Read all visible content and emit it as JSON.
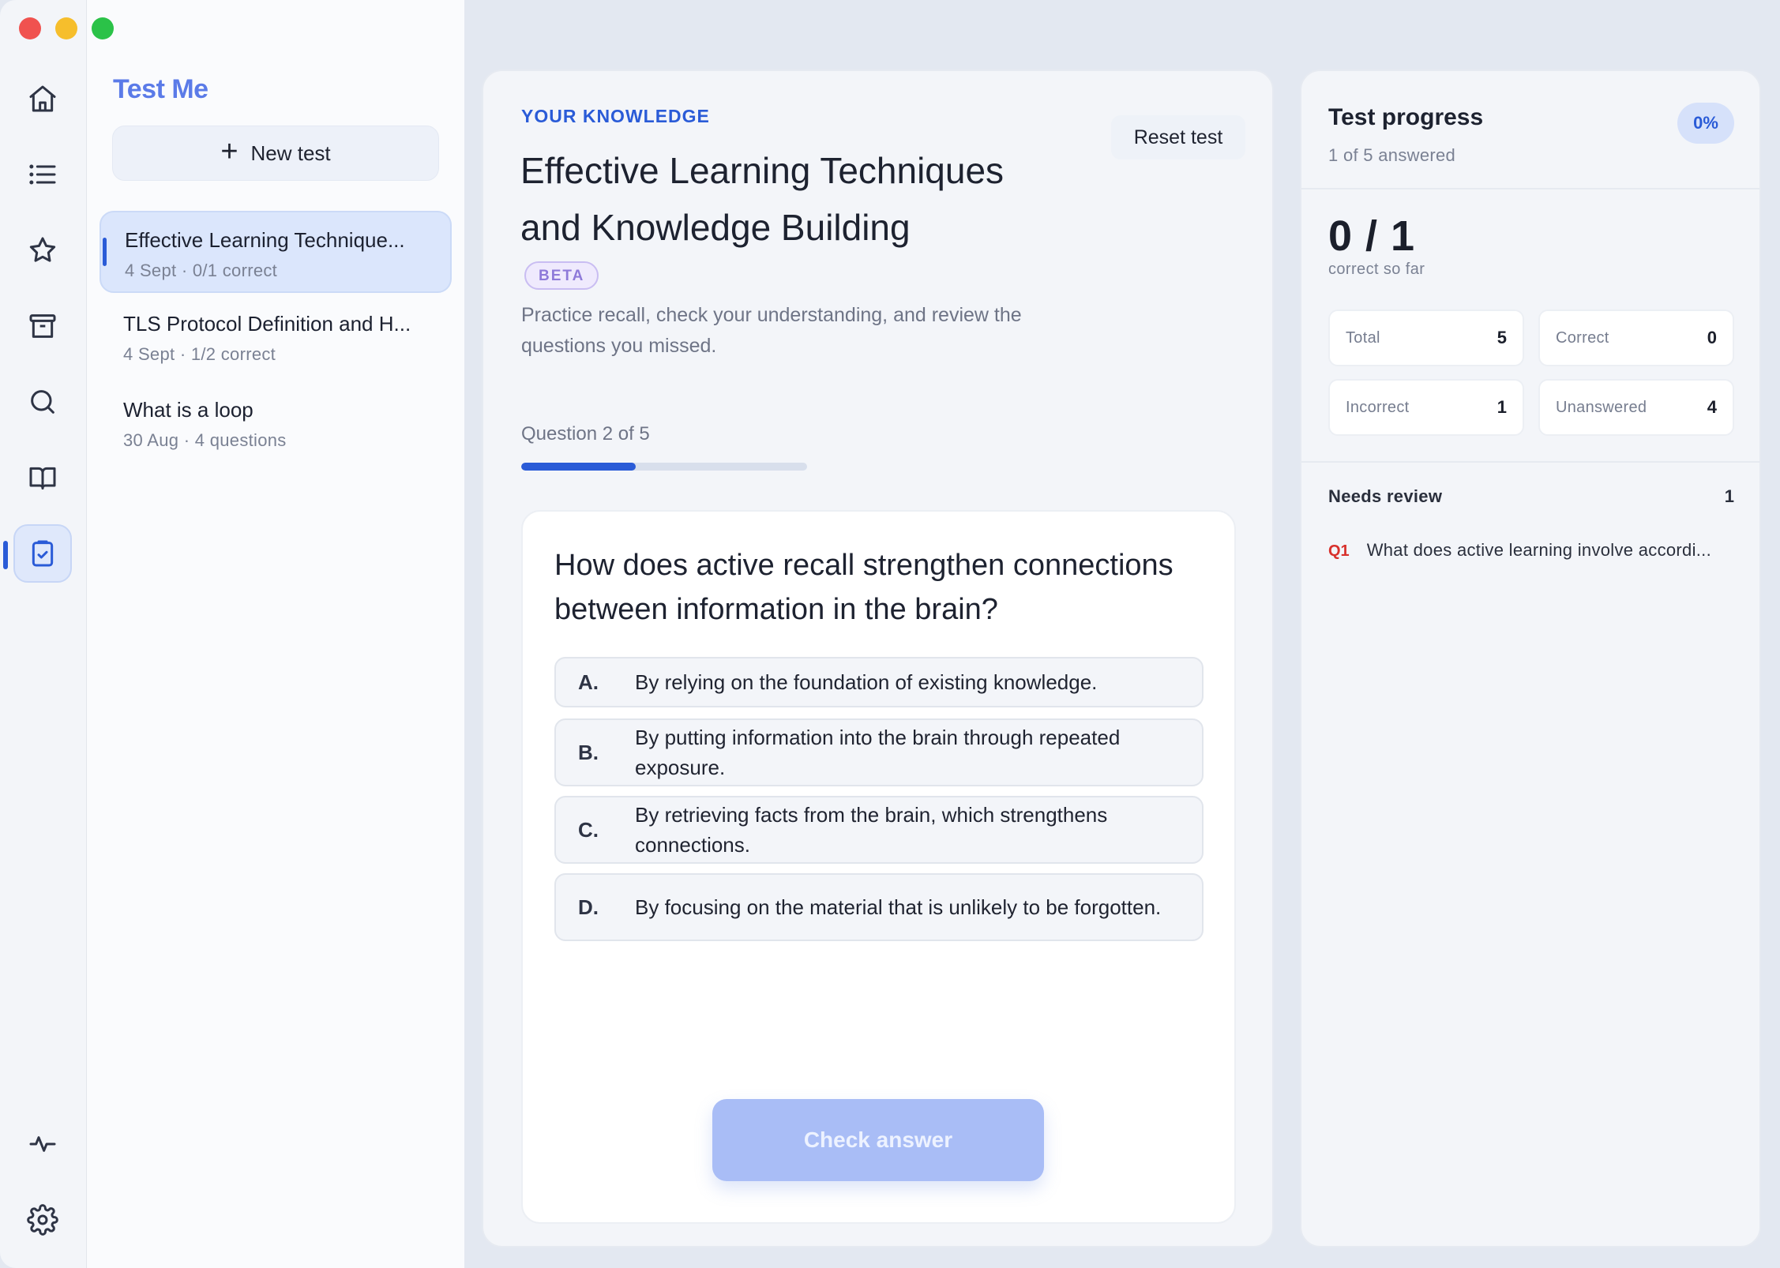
{
  "app": {
    "title": "Test Me"
  },
  "rail": {
    "icons": [
      "home-icon",
      "list-icon",
      "star-icon",
      "archive-icon",
      "search-icon",
      "book-icon",
      "clipboard-check-icon",
      "activity-icon",
      "gear-icon"
    ],
    "active": "clipboard-check-icon"
  },
  "sidebar": {
    "new_test_label": "New test",
    "tests": [
      {
        "title": "Effective Learning Technique...",
        "meta": "4 Sept · 0/1 correct",
        "active": true
      },
      {
        "title": "TLS Protocol Definition and H...",
        "meta": "4 Sept · 1/2 correct",
        "active": false
      },
      {
        "title": "What is a loop",
        "meta": "30 Aug · 4 questions",
        "active": false
      }
    ]
  },
  "main": {
    "eyebrow": "YOUR KNOWLEDGE",
    "reset_label": "Reset test",
    "title": "Effective Learning Techniques and Knowledge Building",
    "badge": "BETA",
    "description": "Practice recall, check your understanding, and review the questions you missed.",
    "question_counter": "Question 2 of 5",
    "progress_fraction": 0.4,
    "question": "How does active recall strengthen connections between information in the brain?",
    "options": [
      {
        "letter": "A.",
        "text": "By relying on the foundation of existing knowledge."
      },
      {
        "letter": "B.",
        "text": "By putting information into the brain through repeated exposure."
      },
      {
        "letter": "C.",
        "text": "By retrieving facts from the brain, which strengthens connections."
      },
      {
        "letter": "D.",
        "text": "By focusing on the material that is unlikely to be forgotten."
      }
    ],
    "check_label": "Check answer"
  },
  "progress_panel": {
    "title": "Test progress",
    "subtitle": "1 of 5 answered",
    "percent": "0%",
    "score": "0 / 1",
    "score_caption": "correct so far",
    "stats": [
      {
        "label": "Total",
        "value": "5"
      },
      {
        "label": "Correct",
        "value": "0"
      },
      {
        "label": "Incorrect",
        "value": "1"
      },
      {
        "label": "Unanswered",
        "value": "4"
      }
    ],
    "needs_review_label": "Needs review",
    "needs_review_count": "1",
    "review_items": [
      {
        "id": "Q1",
        "text": "What does active learning involve accordi..."
      }
    ]
  },
  "colors": {
    "accent": "#2a5bd7",
    "brand_title": "#5b7be8",
    "error": "#d8312c",
    "button_disabled": "#a9bdf6"
  }
}
